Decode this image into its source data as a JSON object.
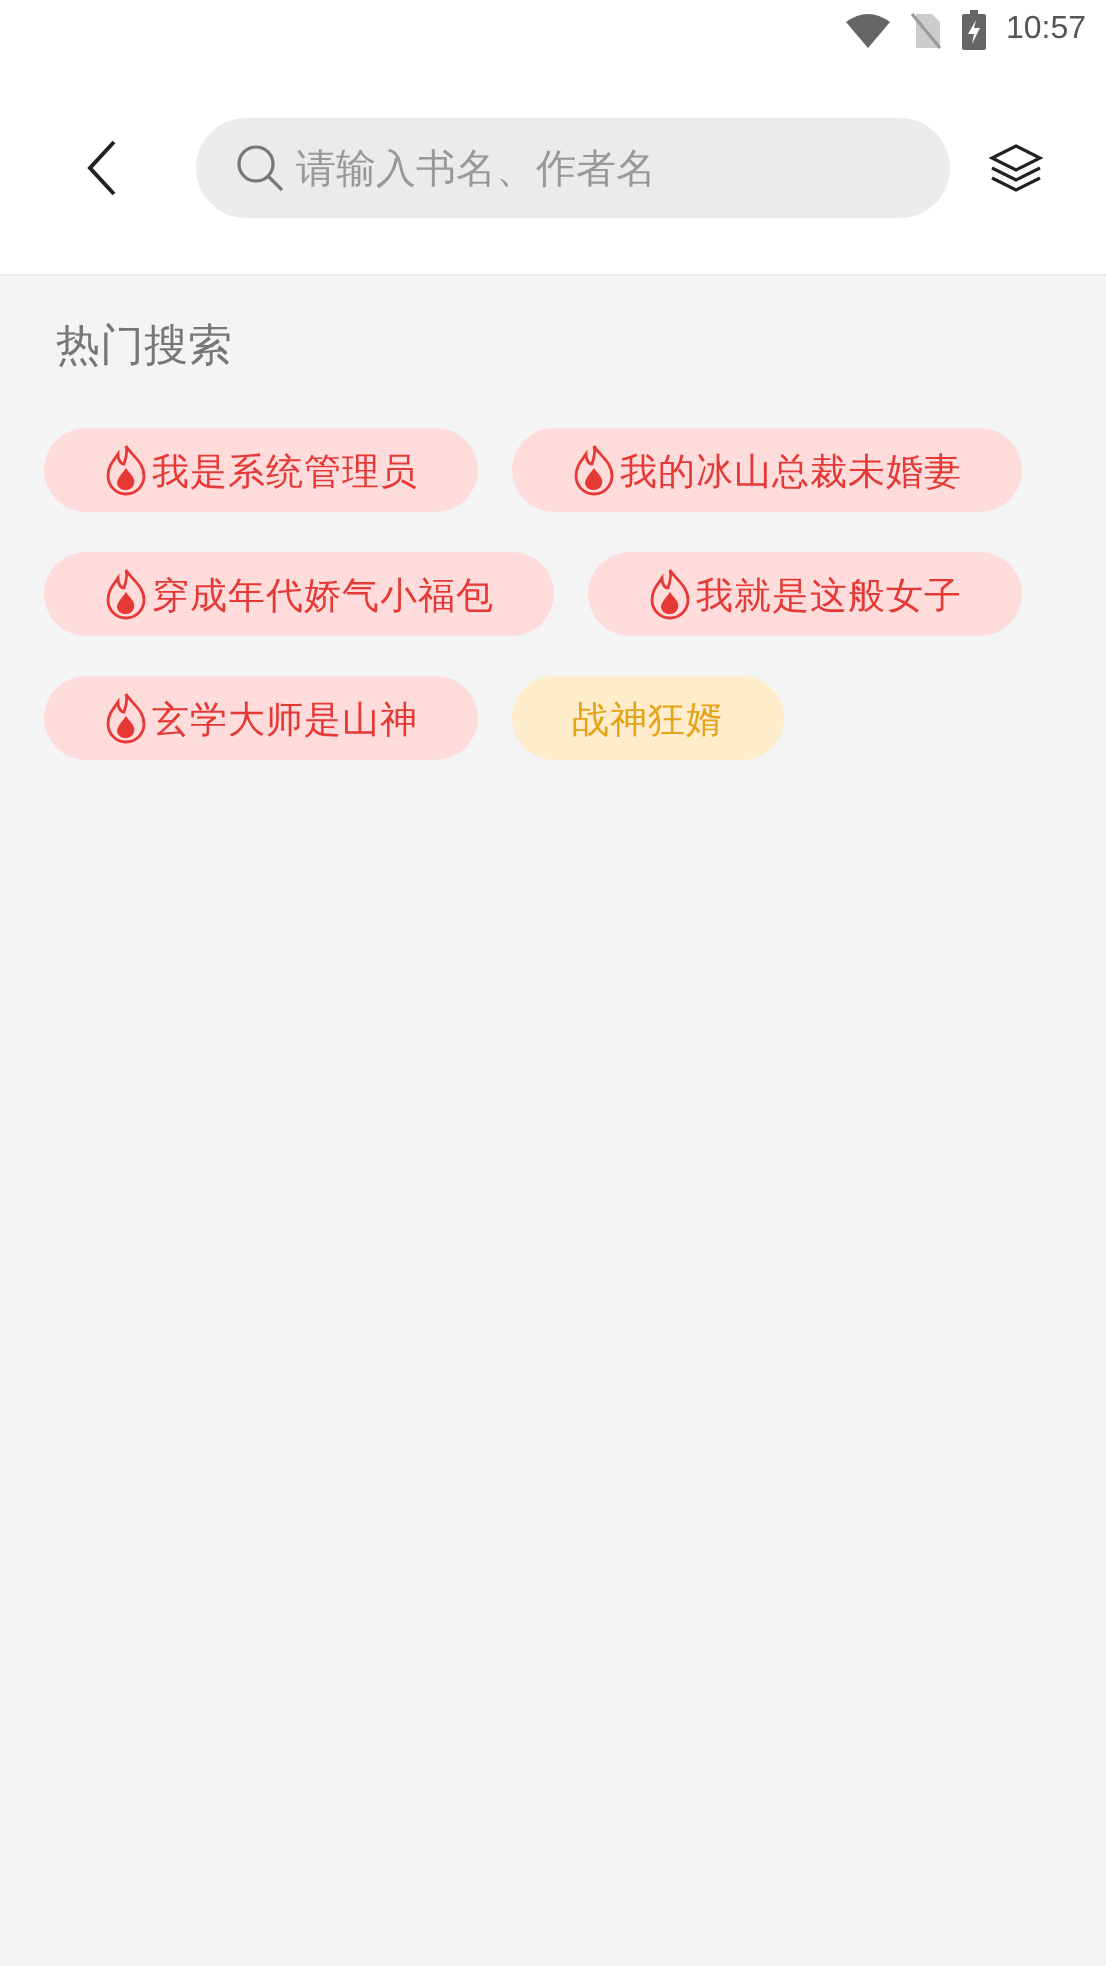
{
  "status_bar": {
    "time": "10:57"
  },
  "search": {
    "placeholder": "请输入书名、作者名"
  },
  "hot_search": {
    "title": "热门搜索",
    "tags": [
      {
        "label": "我是系统管理员",
        "kind": "hot"
      },
      {
        "label": "我的冰山总裁未婚妻",
        "kind": "hot"
      },
      {
        "label": "穿成年代娇气小福包",
        "kind": "hot"
      },
      {
        "label": "我就是这般女子",
        "kind": "hot"
      },
      {
        "label": "玄学大师是山神",
        "kind": "hot"
      },
      {
        "label": "战神狂婿",
        "kind": "plain"
      }
    ]
  }
}
